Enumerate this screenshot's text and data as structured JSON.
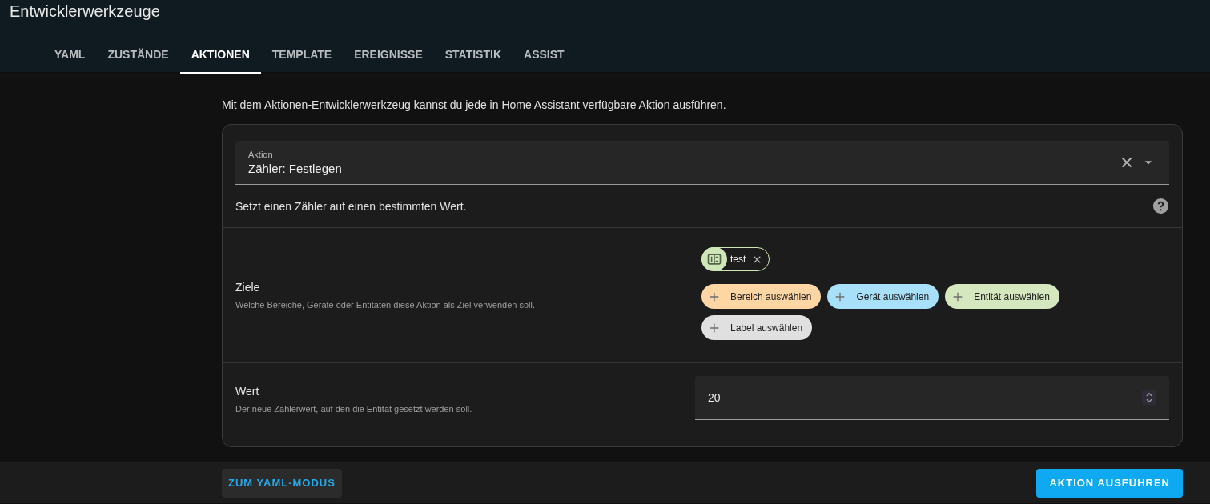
{
  "header": {
    "title": "Entwicklerwerkzeuge"
  },
  "tabs": [
    {
      "label": "YAML",
      "selected": false
    },
    {
      "label": "ZUSTÄNDE",
      "selected": false
    },
    {
      "label": "AKTIONEN",
      "selected": true
    },
    {
      "label": "TEMPLATE",
      "selected": false
    },
    {
      "label": "EREIGNISSE",
      "selected": false
    },
    {
      "label": "STATISTIK",
      "selected": false
    },
    {
      "label": "ASSIST",
      "selected": false
    }
  ],
  "intro": "Mit dem Aktionen-Entwicklerwerkzeug kannst du jede in Home Assistant verfügbare Aktion ausführen.",
  "action_field": {
    "label": "Aktion",
    "value": "Zähler: Festlegen"
  },
  "description": "Setzt einen Zähler auf einen bestimmten Wert.",
  "targets": {
    "title": "Ziele",
    "hint": "Welche Bereiche, Geräte oder Entitäten diese Aktion als Ziel verwenden soll.",
    "chips": [
      {
        "label": "test"
      }
    ],
    "pickers": [
      {
        "label": "Bereich auswählen",
        "color": "#fed6a4"
      },
      {
        "label": "Gerät auswählen",
        "color": "#a8dff9"
      },
      {
        "label": "Entität auswählen",
        "color": "#d4e7be"
      },
      {
        "label": "Label auswählen",
        "color": "#e0e0e0"
      }
    ]
  },
  "value": {
    "title": "Wert",
    "hint": "Der neue Zählerwert, auf den die Entität gesetzt werden soll.",
    "field_value": "20"
  },
  "footer": {
    "yaml_button": "ZUM YAML-MODUS",
    "run_button": "AKTION AUSFÜHREN"
  }
}
